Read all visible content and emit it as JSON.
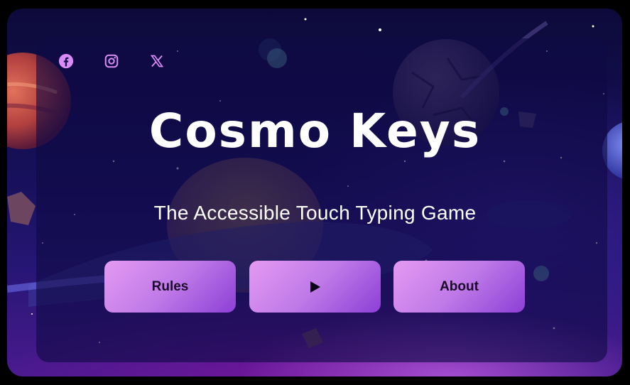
{
  "game": {
    "title": "Cosmo Keys",
    "subtitle": "The Accessible Touch Typing Game"
  },
  "social": [
    {
      "name": "facebook-icon"
    },
    {
      "name": "instagram-icon"
    },
    {
      "name": "x-icon"
    }
  ],
  "buttons": {
    "rules_label": "Rules",
    "play_icon": "play-icon",
    "about_label": "About"
  },
  "colors": {
    "accent_icon": "#d98cf5",
    "button_gradient_start": "#e49af2",
    "button_gradient_end": "#8d3fd6",
    "button_text": "#1a0a2a",
    "title_text": "#ffffff"
  }
}
